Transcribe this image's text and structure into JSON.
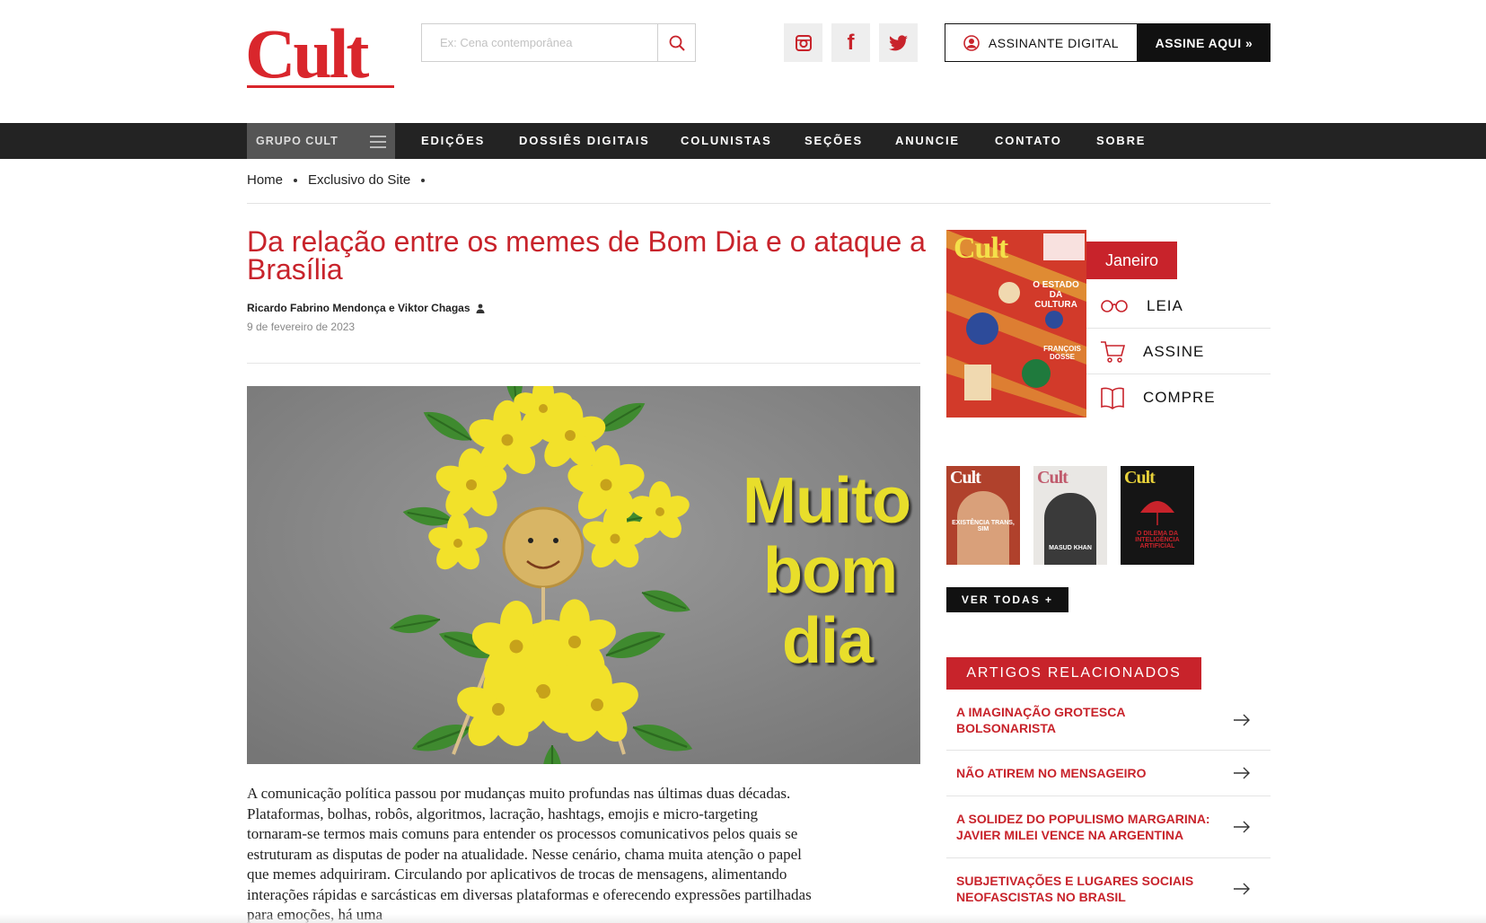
{
  "header": {
    "logo": "Cult",
    "search_placeholder": "Ex: Cena contemporânea",
    "assinante_label": "ASSINANTE DIGITAL",
    "assine_label": "ASSINE AQUI »"
  },
  "nav": {
    "grupo": "GRUPO CULT",
    "items": [
      "EDIÇÕES",
      "DOSSIÊS DIGITAIS",
      "COLUNISTAS",
      "SEÇÕES",
      "ANUNCIE",
      "CONTATO",
      "SOBRE"
    ]
  },
  "breadcrumb": [
    "Home",
    "Exclusivo do Site"
  ],
  "article": {
    "title": "Da relação entre os memes de Bom Dia e o ataque a Brasília",
    "authors": "Ricardo Fabrino Mendonça e Viktor Chagas",
    "date": "9 de fevereiro de 2023",
    "image_text": [
      "Muito",
      "bom",
      "dia"
    ],
    "body": "A comunicação política passou por mudanças muito profundas nas últimas duas décadas. Plataformas, bolhas, robôs, algoritmos, lacração, hashtags, emojis e micro-targeting tornaram-se termos mais comuns para entender os processos comunicativos pelos quais se estruturam as disputas de poder na atualidade. Nesse cenário, chama muita atenção o papel que memes adquiriram. Circulando por aplicativos de trocas de mensagens, alimentando interações rápidas e sarcásticas em diversas plataformas e oferecendo expressões partilhadas para emoções, há uma"
  },
  "edition": {
    "month": "Janeiro",
    "cover_logo": "Cult",
    "cover_headline": "O ESTADO DA CULTURA",
    "cover_name": "FRANÇOIS DOSSE",
    "leia": "LEIA",
    "assine": "ASSINE",
    "compre": "COMPRE"
  },
  "past_editions": [
    {
      "logo": "Cult",
      "title": "EXISTÊNCIA TRANS, SIM",
      "bg": "#b0412c",
      "logo_color": "#ffffff"
    },
    {
      "logo": "Cult",
      "title": "MASUD KHAN",
      "bg": "#e9e7e4",
      "logo_color": "#c05a6c"
    },
    {
      "logo": "Cult",
      "title": "O DILEMA DA INTELIGÊNCIA ARTIFICIAL",
      "bg": "#151515",
      "logo_color": "#e8d23a"
    }
  ],
  "ver_todas": "VER TODAS +",
  "related": {
    "heading": "ARTIGOS RELACIONADOS",
    "items": [
      "A IMAGINAÇÃO GROTESCA BOLSONARISTA",
      "NÃO ATIREM NO MENSAGEIRO",
      "A SOLIDEZ DO POPULISMO MARGARINA: JAVIER MILEI VENCE NA ARGENTINA",
      "SUBJETIVAÇÕES E LUGARES SOCIAIS NEOFASCISTAS NO BRASIL"
    ]
  },
  "colors": {
    "brand_red": "#c8232b",
    "nav_bg": "#232323",
    "flower_yellow": "#f2e12a"
  }
}
